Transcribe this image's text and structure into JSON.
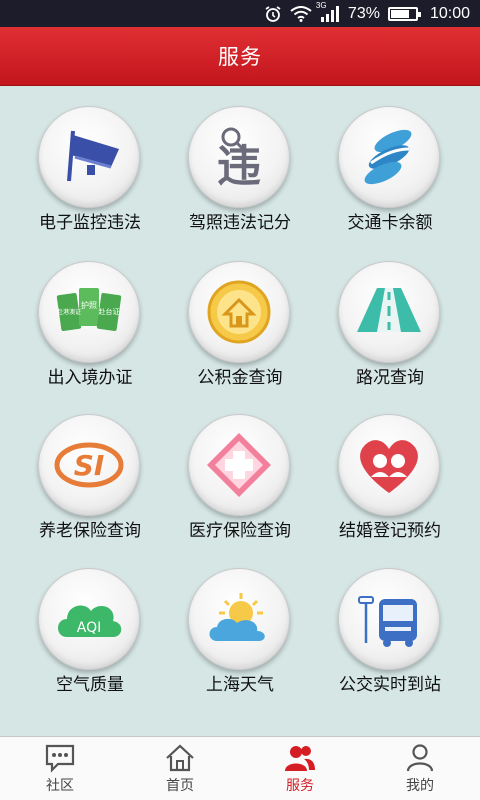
{
  "status_bar": {
    "network": "3G",
    "battery": "73%",
    "time": "10:00",
    "icons": [
      "alarm-icon",
      "wifi-icon",
      "signal-icon",
      "battery-icon"
    ]
  },
  "header": {
    "title": "服务"
  },
  "services": [
    {
      "label": "电子监控违法",
      "icon": "camera-icon"
    },
    {
      "label": "驾照违法记分",
      "icon": "violation-char-icon",
      "icon_text": "违"
    },
    {
      "label": "交通卡余额",
      "icon": "transport-card-icon"
    },
    {
      "label": "出入境办证",
      "icon": "passport-cards-icon",
      "icon_texts": [
        "赴港澳证",
        "护照",
        "赴台证"
      ]
    },
    {
      "label": "公积金查询",
      "icon": "housing-fund-icon"
    },
    {
      "label": "路况查询",
      "icon": "road-icon"
    },
    {
      "label": "养老保险查询",
      "icon": "social-insurance-icon",
      "icon_text": "SI"
    },
    {
      "label": "医疗保险查询",
      "icon": "medical-cross-icon"
    },
    {
      "label": "结婚登记预约",
      "icon": "marriage-heart-icon"
    },
    {
      "label": "空气质量",
      "icon": "aqi-cloud-icon",
      "icon_text": "AQI"
    },
    {
      "label": "上海天气",
      "icon": "weather-icon"
    },
    {
      "label": "公交实时到站",
      "icon": "bus-icon"
    }
  ],
  "bottom_nav": [
    {
      "label": "社区",
      "icon": "chat-bubble-icon",
      "active": false
    },
    {
      "label": "首页",
      "icon": "home-icon",
      "active": false
    },
    {
      "label": "服务",
      "icon": "people-icon",
      "active": true
    },
    {
      "label": "我的",
      "icon": "user-icon",
      "active": false
    }
  ],
  "colors": {
    "header": "#d51e24",
    "background": "#d5e6e5",
    "active_tab": "#d51e24"
  }
}
